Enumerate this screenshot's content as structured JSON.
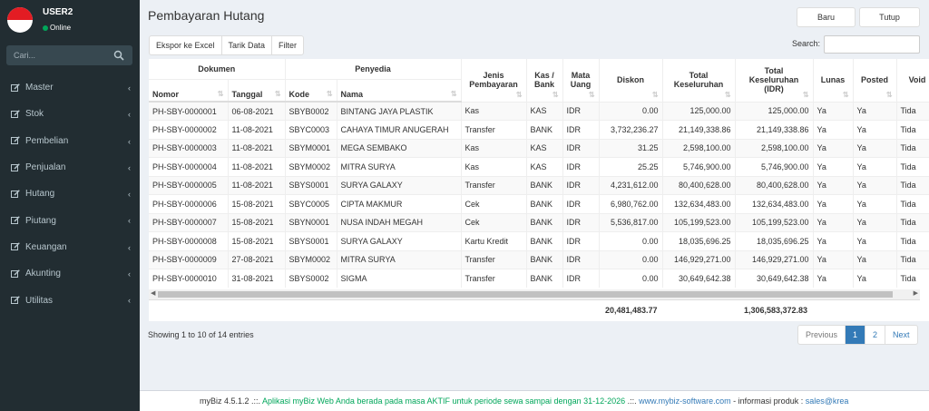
{
  "user": {
    "name": "USER2",
    "status": "Online"
  },
  "sidebar": {
    "search_placeholder": "Cari...",
    "items": [
      {
        "label": "Master",
        "icon": "edit-icon"
      },
      {
        "label": "Stok",
        "icon": "edit-icon"
      },
      {
        "label": "Pembelian",
        "icon": "edit-icon"
      },
      {
        "label": "Penjualan",
        "icon": "edit-icon"
      },
      {
        "label": "Hutang",
        "icon": "edit-icon"
      },
      {
        "label": "Piutang",
        "icon": "edit-icon"
      },
      {
        "label": "Keuangan",
        "icon": "edit-icon"
      },
      {
        "label": "Akunting",
        "icon": "edit-icon"
      },
      {
        "label": "Utilitas",
        "icon": "edit-icon"
      }
    ]
  },
  "page": {
    "title": "Pembayaran Hutang",
    "new_label": "Baru",
    "close_label": "Tutup"
  },
  "toolbar": {
    "export": "Ekspor ke Excel",
    "fetch": "Tarik Data",
    "filter": "Filter",
    "search_label": "Search:"
  },
  "table": {
    "groups": {
      "dokumen": "Dokumen",
      "penyedia": "Penyedia"
    },
    "headers": {
      "nomor": "Nomor",
      "tanggal": "Tanggal",
      "kode": "Kode",
      "nama": "Nama",
      "jenis": "Jenis Pembayaran",
      "kas": "Kas / Bank",
      "mata": "Mata Uang",
      "diskon": "Diskon",
      "total": "Total Keseluruhan",
      "totalidr": "Total Keseluruhan (IDR)",
      "lunas": "Lunas",
      "posted": "Posted",
      "void": "Void"
    },
    "rows": [
      [
        "PH-SBY-0000001",
        "06-08-2021",
        "SBYB0002",
        "BINTANG JAYA PLASTIK",
        "Kas",
        "KAS",
        "IDR",
        "0.00",
        "125,000.00",
        "125,000.00",
        "Ya",
        "Ya",
        "Tida"
      ],
      [
        "PH-SBY-0000002",
        "11-08-2021",
        "SBYC0003",
        "CAHAYA TIMUR ANUGERAH",
        "Transfer",
        "BANK",
        "IDR",
        "3,732,236.27",
        "21,149,338.86",
        "21,149,338.86",
        "Ya",
        "Ya",
        "Tida"
      ],
      [
        "PH-SBY-0000003",
        "11-08-2021",
        "SBYM0001",
        "MEGA SEMBAKO",
        "Kas",
        "KAS",
        "IDR",
        "31.25",
        "2,598,100.00",
        "2,598,100.00",
        "Ya",
        "Ya",
        "Tida"
      ],
      [
        "PH-SBY-0000004",
        "11-08-2021",
        "SBYM0002",
        "MITRA SURYA",
        "Kas",
        "KAS",
        "IDR",
        "25.25",
        "5,746,900.00",
        "5,746,900.00",
        "Ya",
        "Ya",
        "Tida"
      ],
      [
        "PH-SBY-0000005",
        "11-08-2021",
        "SBYS0001",
        "SURYA GALAXY",
        "Transfer",
        "BANK",
        "IDR",
        "4,231,612.00",
        "80,400,628.00",
        "80,400,628.00",
        "Ya",
        "Ya",
        "Tida"
      ],
      [
        "PH-SBY-0000006",
        "15-08-2021",
        "SBYC0005",
        "CIPTA MAKMUR",
        "Cek",
        "BANK",
        "IDR",
        "6,980,762.00",
        "132,634,483.00",
        "132,634,483.00",
        "Ya",
        "Ya",
        "Tida"
      ],
      [
        "PH-SBY-0000007",
        "15-08-2021",
        "SBYN0001",
        "NUSA INDAH MEGAH",
        "Cek",
        "BANK",
        "IDR",
        "5,536,817.00",
        "105,199,523.00",
        "105,199,523.00",
        "Ya",
        "Ya",
        "Tida"
      ],
      [
        "PH-SBY-0000008",
        "15-08-2021",
        "SBYS0001",
        "SURYA GALAXY",
        "Kartu Kredit",
        "BANK",
        "IDR",
        "0.00",
        "18,035,696.25",
        "18,035,696.25",
        "Ya",
        "Ya",
        "Tida"
      ],
      [
        "PH-SBY-0000009",
        "27-08-2021",
        "SBYM0002",
        "MITRA SURYA",
        "Transfer",
        "BANK",
        "IDR",
        "0.00",
        "146,929,271.00",
        "146,929,271.00",
        "Ya",
        "Ya",
        "Tida"
      ],
      [
        "PH-SBY-0000010",
        "31-08-2021",
        "SBYS0002",
        "SIGMA",
        "Transfer",
        "BANK",
        "IDR",
        "0.00",
        "30,649,642.38",
        "30,649,642.38",
        "Ya",
        "Ya",
        "Tida"
      ]
    ],
    "totals": {
      "diskon": "20,481,483.77",
      "totalidr": "1,306,583,372.83"
    }
  },
  "pagination": {
    "info": "Showing 1 to 10 of 14 entries",
    "previous": "Previous",
    "page1": "1",
    "page2": "2",
    "next": "Next"
  },
  "footer": {
    "version": "myBiz 4.5.1.2",
    "sep1": " .::. ",
    "notice": "Aplikasi myBiz Web Anda berada pada masa AKTIF untuk periode sewa sampai dengan 31-12-2026",
    "sep2": " .::. ",
    "site": "www.mybiz-software.com",
    "info": " - informasi produk : ",
    "email": "sales@krea"
  },
  "colors": {
    "sidebar": "#222d32",
    "accent": "#337ab7",
    "online": "#00a65a"
  }
}
